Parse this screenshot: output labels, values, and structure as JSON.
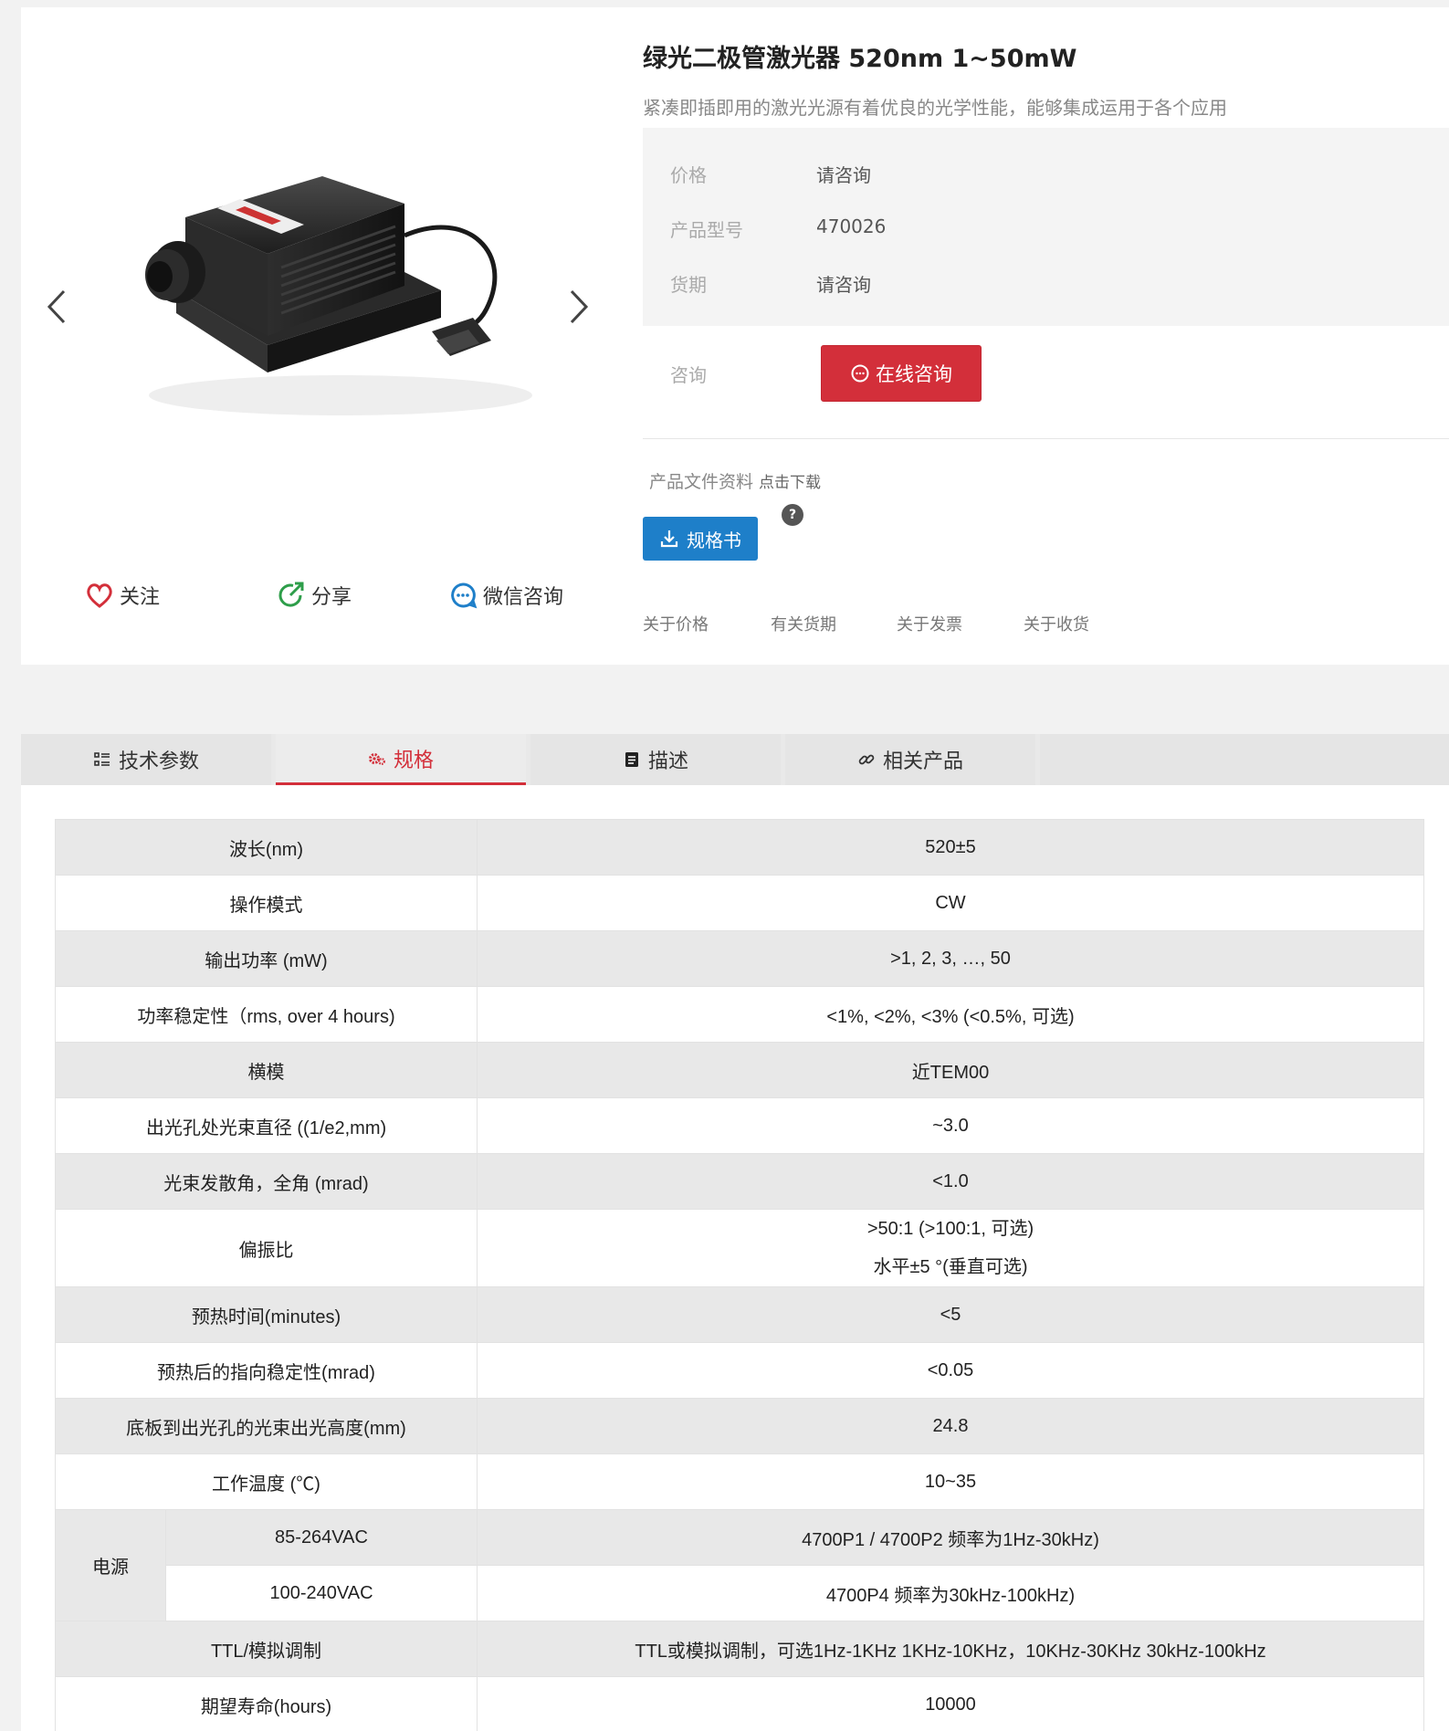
{
  "product": {
    "title": "绿光二极管激光器 520nm 1~50mW",
    "subtitle": "紧凑即插即用的激光光源有着优良的光学性能，能够集成运用于各个应用",
    "image_alt": "laser-module"
  },
  "attributes": [
    {
      "key": "价格",
      "value": "请咨询"
    },
    {
      "key": "产品型号",
      "value": "470026"
    },
    {
      "key": "货期",
      "value": "请咨询"
    }
  ],
  "consult": {
    "label": "咨询",
    "button": "在线咨询"
  },
  "files": {
    "label": "产品文件资料",
    "download": "点击下载",
    "spec_button": "规格书",
    "help": "?"
  },
  "faq": [
    "关于价格",
    "有关货期",
    "关于发票",
    "关于收货"
  ],
  "actions": {
    "follow": "关注",
    "share": "分享",
    "wechat": "微信咨询"
  },
  "tabs": [
    {
      "label": "技术参数",
      "icon": "list-icon"
    },
    {
      "label": "规格",
      "icon": "gears-icon",
      "active": true
    },
    {
      "label": "描述",
      "icon": "document-icon"
    },
    {
      "label": "相关产品",
      "icon": "link-icon"
    }
  ],
  "specs": [
    {
      "label": "波长(nm)",
      "value": "520±5"
    },
    {
      "label": "操作模式",
      "value": "CW"
    },
    {
      "label": "输出功率 (mW)",
      "value": ">1, 2, 3, …, 50"
    },
    {
      "label": "功率稳定性（rms, over 4 hours)",
      "value": "<1%, <2%, <3% (<0.5%, 可选)"
    },
    {
      "label": "横模",
      "value": "近TEM00"
    },
    {
      "label": "出光孔处光束直径 ((1/e2,mm)",
      "value": "~3.0"
    },
    {
      "label": "光束发散角，全角 (mrad)",
      "value": "<1.0"
    },
    {
      "label": "偏振比",
      "value": ">50:1 (>100:1, 可选)",
      "value2": "水平±5 °(垂直可选)"
    },
    {
      "label": "预热时间(minutes)",
      "value": "<5"
    },
    {
      "label": "预热后的指向稳定性(mrad)",
      "value": "<0.05"
    },
    {
      "label": "底板到出光孔的光束出光高度(mm)",
      "value": "24.8"
    },
    {
      "label": "工作温度 (℃)",
      "value": "10~35"
    }
  ],
  "power": {
    "label": "电源",
    "rows": [
      {
        "sub": "85-264VAC",
        "value": "4700P1 / 4700P2 频率为1Hz-30kHz)"
      },
      {
        "sub": "100-240VAC",
        "value": "4700P4 频率为30kHz-100kHz)"
      }
    ]
  },
  "specs_after": [
    {
      "label": "TTL/模拟调制",
      "value": "TTL或模拟调制，可选1Hz-1KHz 1KHz-10KHz，10KHz-30KHz 30kHz-100kHz"
    },
    {
      "label": "期望寿命(hours)",
      "value": "10000"
    }
  ],
  "colors": {
    "accent": "#d32f3a",
    "primary": "#1e7fc9"
  }
}
